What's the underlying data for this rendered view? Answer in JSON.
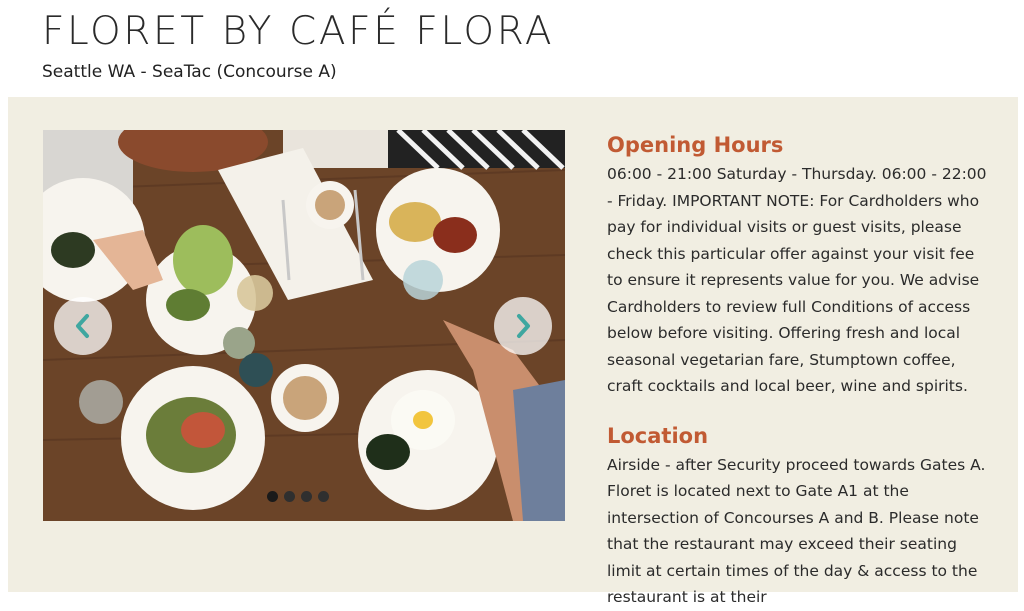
{
  "header": {
    "title": "FLORET BY CAFÉ FLORA",
    "subtitle": "Seattle WA - SeaTac (Concourse A)"
  },
  "carousel": {
    "image_alt": "Overhead view of a wooden table with plates of salad, eggs, greens and coffee",
    "slide_count": 4,
    "active_slide": 1,
    "prev_icon": "chevron-left-icon",
    "next_icon": "chevron-right-icon"
  },
  "opening_hours": {
    "heading": "Opening Hours",
    "body": "06:00 - 21:00 Saturday - Thursday. 06:00 - 22:00 - Friday. IMPORTANT NOTE: For Cardholders who pay for individual visits or guest visits, please check this particular offer against your visit fee to ensure it represents value for you. We advise Cardholders to review full Conditions of access below before visiting. Offering fresh and local seasonal vegetarian fare, Stumptown coffee, craft cocktails and local beer, wine and spirits."
  },
  "location": {
    "heading": "Location",
    "body": "Airside - after Security proceed towards Gates A. Floret is located next to Gate A1 at the intersection of Concourses A and B. Please note that the restaurant may exceed their seating limit at certain times of the day & access to the restaurant is at their"
  },
  "colors": {
    "heading": "#c15a33",
    "panel": "#f1eee2",
    "arrow": "#3fa7a0"
  }
}
